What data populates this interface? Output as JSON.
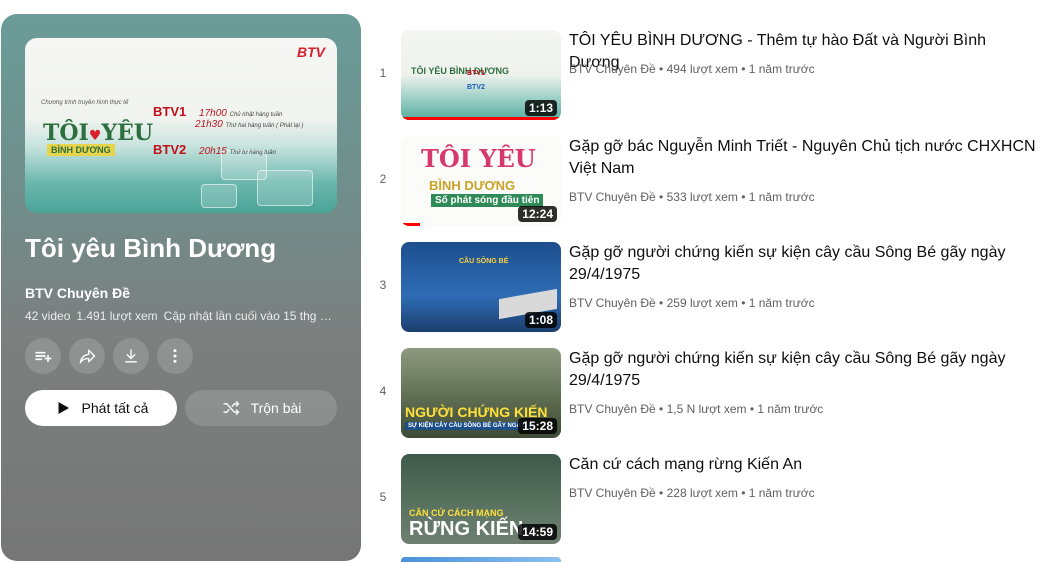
{
  "playlist": {
    "title": "Tôi yêu Bình Dương",
    "owner": "BTV Chuyên Đề",
    "video_count": "42 video",
    "views": "1.491 lượt xem",
    "updated": "Cập nhật lần cuối vào 15 thg 1…",
    "play_all_label": "Phát tất cả",
    "shuffle_label": "Trộn bài",
    "hero": {
      "btv_logo": "BTV",
      "intro": "Chương trình truyền hình thực tế",
      "logo_line1": "TÔI",
      "logo_heart": "♥",
      "logo_line1b": "YÊU",
      "logo_line2": "BÌNH DƯƠNG",
      "btv1": "BTV1",
      "btv1_time1": "17h00",
      "btv1_day1": "Chủ nhật hàng tuần",
      "btv1_time2": "21h30",
      "btv1_day2": "Thứ hai hàng tuần ( Phát lại )",
      "btv2": "BTV2",
      "btv2_time": "20h15",
      "btv2_day": "Thứ tư hàng tuần"
    }
  },
  "videos": [
    {
      "index": "1",
      "title": "TÔI YÊU BÌNH DƯƠNG - Thêm tự hào Đất và Người Bình Dương",
      "channel": "BTV Chuyên Đề",
      "views": "494 lượt xem",
      "age": "1 năm trước",
      "duration": "1:13",
      "thumb_text": "TÔI YÊU BÌNH DƯƠNG"
    },
    {
      "index": "2",
      "title": "Gặp gỡ bác Nguyễn Minh Triết - Nguyên Chủ tịch nước CHXHCN Việt Nam",
      "channel": "BTV Chuyên Đề",
      "views": "533 lượt xem",
      "age": "1 năm trước",
      "duration": "12:24",
      "thumb_text": "TÔI YÊU",
      "thumb_text2": "BÌNH DƯƠNG",
      "thumb_text3": "Số phát sóng đầu tiên"
    },
    {
      "index": "3",
      "title": "Gặp gỡ người chứng kiến sự kiện cây cầu Sông Bé gãy ngày 29/4/1975",
      "channel": "BTV Chuyên Đề",
      "views": "259 lượt xem",
      "age": "1 năm trước",
      "duration": "1:08",
      "thumb_text": "CẦU SÔNG BÉ"
    },
    {
      "index": "4",
      "title": "Gặp gỡ người chứng kiến sự kiện cây cầu Sông Bé gãy ngày 29/4/1975",
      "channel": "BTV Chuyên Đề",
      "views": "1,5 N lượt xem",
      "age": "1 năm trước",
      "duration": "15:28",
      "thumb_text": "NGƯỜI CHỨNG KIẾN",
      "thumb_text2": "SỰ KIỆN CÂY CẦU SÔNG BÉ GÃY NGÀY..."
    },
    {
      "index": "5",
      "title": "Căn cứ cách mạng rừng Kiến An",
      "channel": "BTV Chuyên Đề",
      "views": "228 lượt xem",
      "age": "1 năm trước",
      "duration": "14:59",
      "thumb_text": "CĂN CỨ CÁCH MẠNG",
      "thumb_text2": "RỪNG KIẾN"
    }
  ],
  "icons": {
    "save": "playlist-add-icon",
    "share": "share-icon",
    "download": "download-icon",
    "more": "more-vert-icon",
    "play": "play-icon",
    "shuffle": "shuffle-icon"
  }
}
